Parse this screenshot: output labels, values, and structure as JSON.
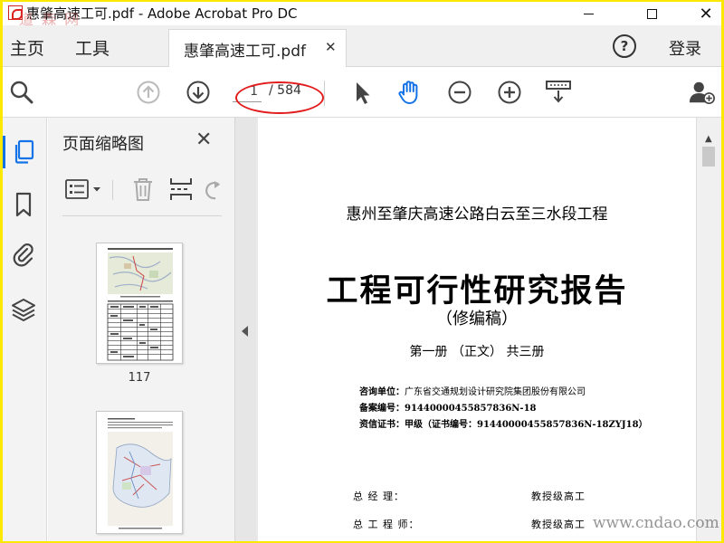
{
  "window": {
    "title": "惠肇高速工可.pdf - Adobe Acrobat Pro DC",
    "watermark_top": "道 森 网",
    "minimize_icon": "minimize-icon",
    "maximize_icon": "maximize-icon",
    "close_glyph": "✕"
  },
  "menu": {
    "home": "主页",
    "tools": "工具",
    "tab_label": "惠肇高速工可.pdf",
    "tab_close": "✕",
    "help": "?",
    "login": "登录"
  },
  "toolbar": {
    "current_page": "1",
    "total_pages": "/ 584",
    "icons": [
      "search-icon",
      "page-up-icon",
      "page-down-icon",
      "select-arrow-icon",
      "hand-tool-icon",
      "zoom-out-icon",
      "zoom-in-icon",
      "keyboard-scroll-icon",
      "add-user-icon"
    ],
    "accent_color": "#1473e6",
    "annotation_color": "#e21c1c"
  },
  "rail": {
    "icons": [
      "page-thumbnails-icon",
      "bookmarks-icon",
      "attachments-icon",
      "layers-icon"
    ]
  },
  "thumbnail_panel": {
    "title": "页面缩略图",
    "close": "✕",
    "tools": [
      "thumbnail-options-icon",
      "delete-icon",
      "insert-page-icon",
      "rotate-icon"
    ],
    "pages": [
      {
        "label": "117"
      },
      {
        "label": ""
      }
    ]
  },
  "document": {
    "subtitle": "惠州至肇庆高速公路白云至三水段工程",
    "title": "工程可行性研究报告",
    "revision": "（修编稿）",
    "volume": "第一册 （正文）      共三册",
    "consult_label": "咨询单位：",
    "consult_value": "广东省交通规划设计研究院集团股份有限公司",
    "record_label": "备案编号：",
    "record_value": "91440000455857836N-18",
    "cert_label": "资信证书：",
    "cert_value": "甲级（证书编号：91440000455857836N-18ZYJ18）",
    "sign1_role": "总     经     理：",
    "sign1_title": "教授级高工",
    "sign2_role": "总   工   程   师：",
    "sign2_title": "教授级高工"
  },
  "watermark_bottom": "www.cndao.com"
}
